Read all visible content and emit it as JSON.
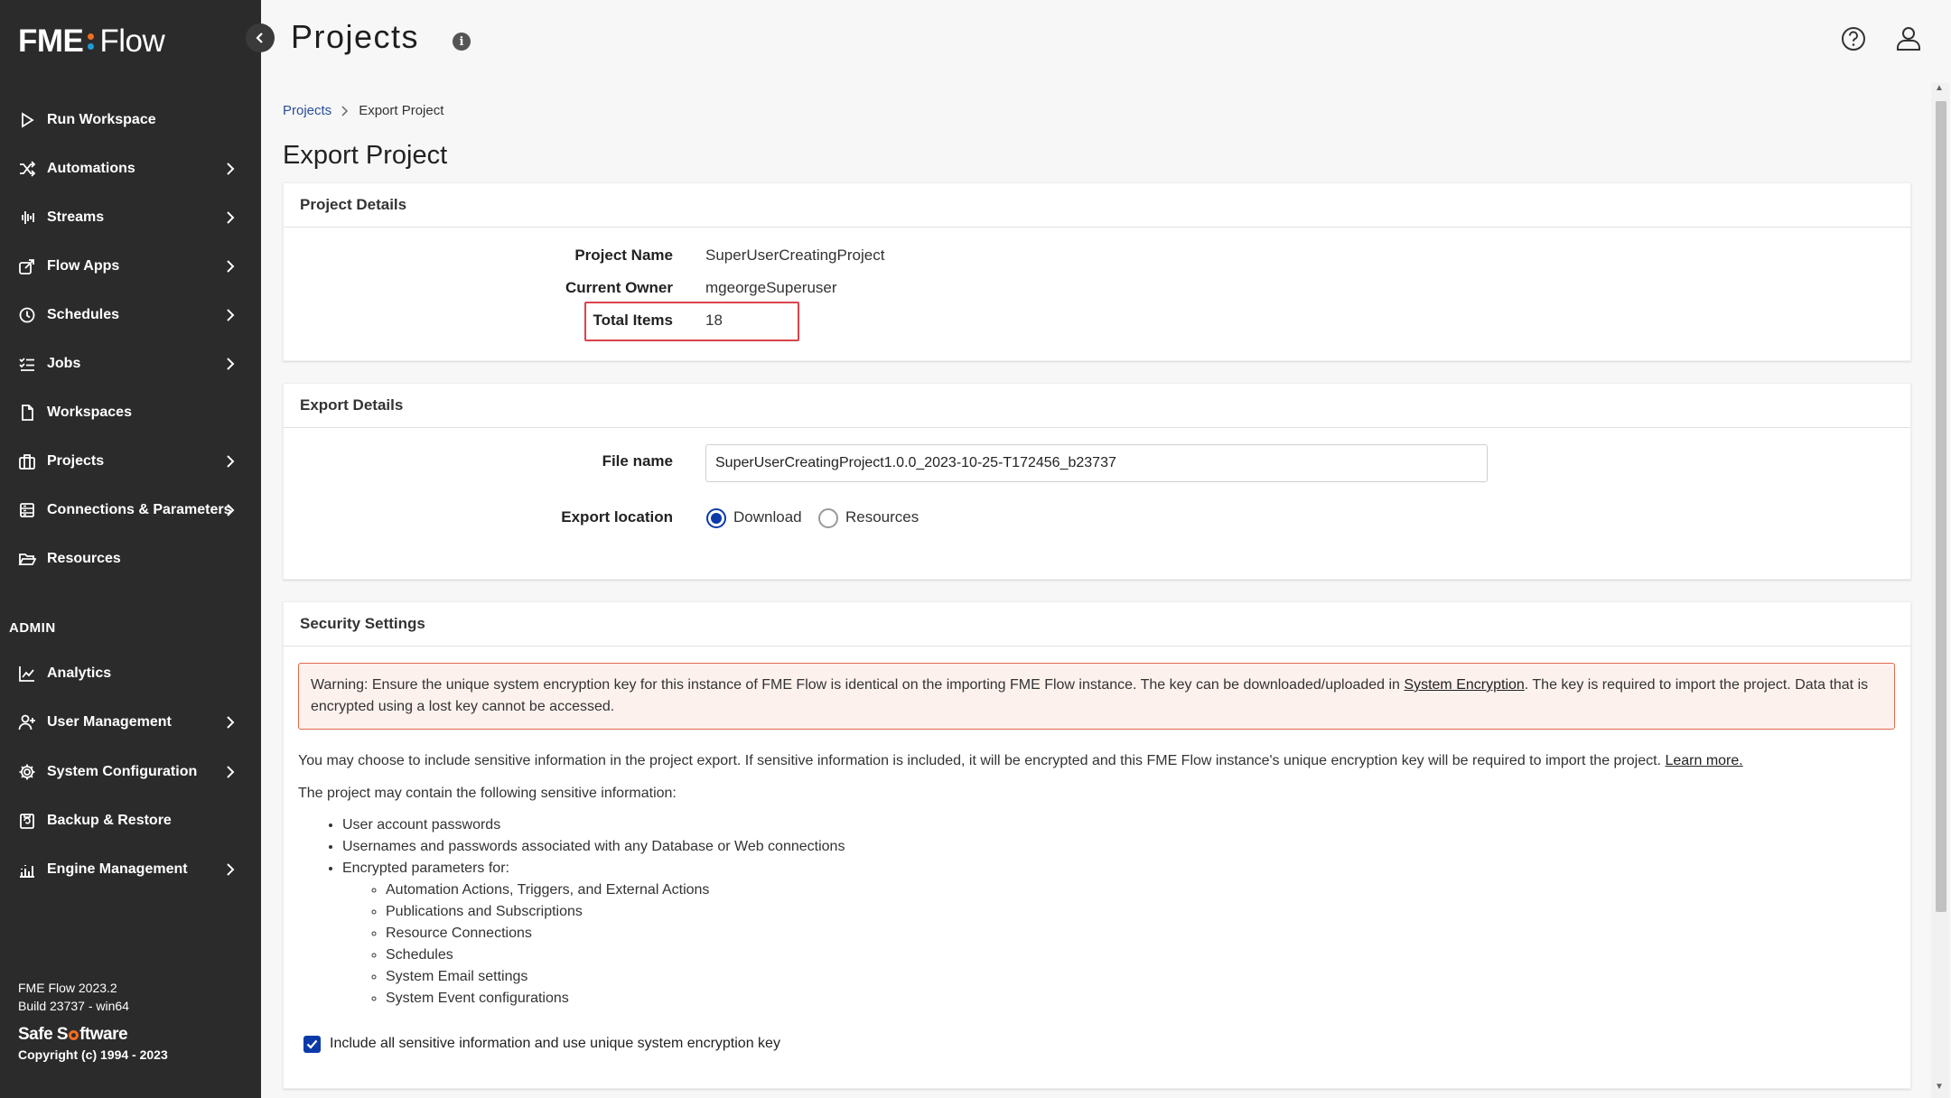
{
  "app": {
    "logo_fme": "FME",
    "logo_flow": "Flow",
    "page_title": "Projects"
  },
  "sidebar": {
    "items": [
      {
        "label": "Run Workspace",
        "icon": "play-icon",
        "chevron": false
      },
      {
        "label": "Automations",
        "icon": "shuffle-icon",
        "chevron": true
      },
      {
        "label": "Streams",
        "icon": "waveform-icon",
        "chevron": true
      },
      {
        "label": "Flow Apps",
        "icon": "share-app-icon",
        "chevron": true
      },
      {
        "label": "Schedules",
        "icon": "clock-icon",
        "chevron": true
      },
      {
        "label": "Jobs",
        "icon": "list-check-icon",
        "chevron": true
      },
      {
        "label": "Workspaces",
        "icon": "file-icon",
        "chevron": false
      },
      {
        "label": "Projects",
        "icon": "briefcase-icon",
        "chevron": true
      },
      {
        "label": "Connections & Parameters",
        "icon": "database-icon",
        "chevron": true
      },
      {
        "label": "Resources",
        "icon": "folder-open-icon",
        "chevron": false
      }
    ],
    "admin_header": "ADMIN",
    "admin_items": [
      {
        "label": "Analytics",
        "icon": "line-chart-icon",
        "chevron": false
      },
      {
        "label": "User Management",
        "icon": "user-plus-icon",
        "chevron": true
      },
      {
        "label": "System Configuration",
        "icon": "gear-icon",
        "chevron": true
      },
      {
        "label": "Backup & Restore",
        "icon": "backup-icon",
        "chevron": false
      },
      {
        "label": "Engine Management",
        "icon": "bar-chart-icon",
        "chevron": true
      }
    ],
    "version_line1": "FME Flow 2023.2",
    "version_line2": "Build 23737 - win64",
    "safe_software_1": "Safe S",
    "safe_software_2": "ftware",
    "copyright": "Copyright (c) 1994 - 2023"
  },
  "breadcrumb": {
    "link": "Projects",
    "current": "Export Project"
  },
  "export_title": "Export Project",
  "project_details": {
    "header": "Project Details",
    "name_label": "Project Name",
    "name_value": "SuperUserCreatingProject",
    "owner_label": "Current Owner",
    "owner_value": "mgeorgeSuperuser",
    "items_label": "Total Items",
    "items_value": "18"
  },
  "export_details": {
    "header": "Export Details",
    "file_label": "File name",
    "file_value": "SuperUserCreatingProject1.0.0_2023-10-25-T172456_b23737",
    "location_label": "Export location",
    "option_download": "Download",
    "option_resources": "Resources",
    "selected": "Download"
  },
  "security": {
    "header": "Security Settings",
    "warning_pre": "Warning: Ensure the unique system encryption key for this instance of FME Flow is identical on the importing FME Flow instance. The key can be downloaded/uploaded in ",
    "warning_link": "System Encryption",
    "warning_post": ". The key is required to import the project. Data that is encrypted using a lost key cannot be accessed.",
    "para1": "You may choose to include sensitive information in the project export. If sensitive information is included, it will be encrypted and this FME Flow instance's unique encryption key will be required to import the project. ",
    "para1_link": "Learn more.",
    "para2": "The project may contain the following sensitive information:",
    "list": [
      "User account passwords",
      "Usernames and passwords associated with any Database or Web connections",
      "Encrypted parameters for:"
    ],
    "sublist": [
      "Automation Actions, Triggers, and External Actions",
      "Publications and Subscriptions",
      "Resource Connections",
      "Schedules",
      "System Email settings",
      "System Event configurations"
    ],
    "checkbox_label": "Include all sensitive information and use unique system encryption key",
    "checkbox_checked": true
  },
  "colors": {
    "sidebar_bg": "#2b2b2b",
    "accent_blue": "#0a3aa8",
    "logo_orange": "#f26d21",
    "logo_blue": "#1e9bd7",
    "warning_border": "#e16a4a",
    "highlight_red": "#d9444d"
  }
}
